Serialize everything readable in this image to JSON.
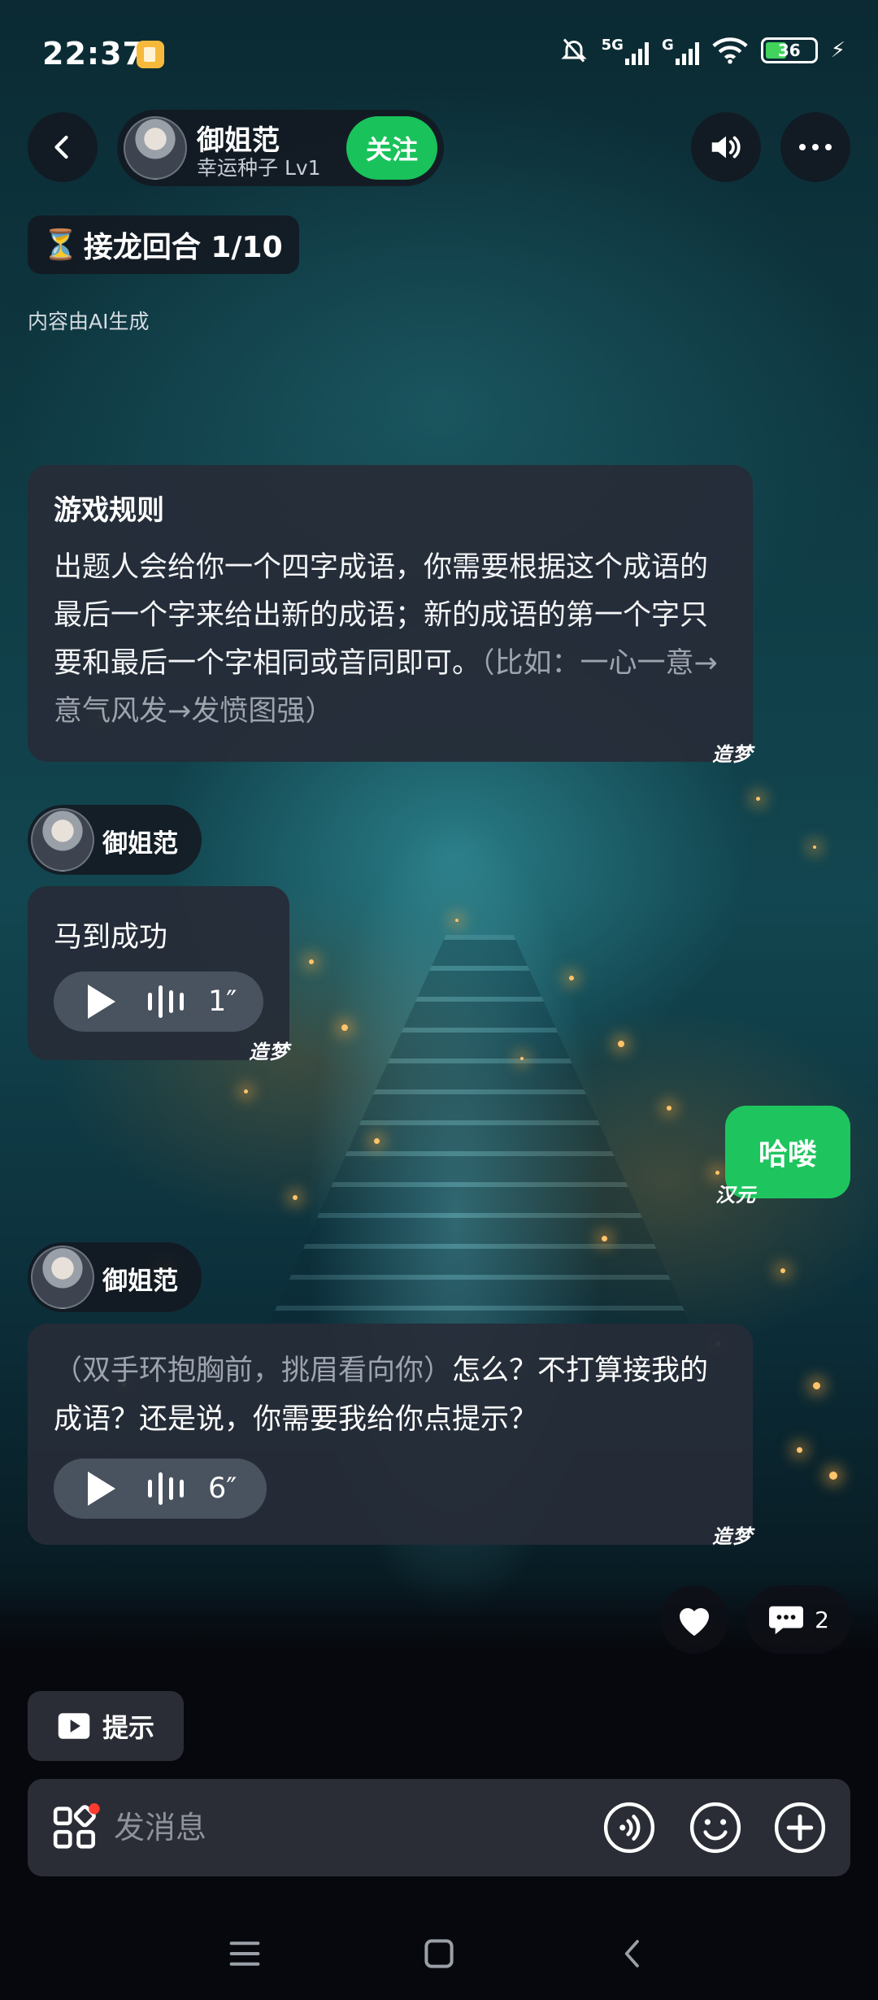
{
  "status_bar": {
    "time": "22:37",
    "network_1": "5G",
    "network_2": "G",
    "battery": "36"
  },
  "header": {
    "profile_name": "御姐范",
    "profile_level": "幸运种子 Lv1",
    "follow_label": "关注"
  },
  "round_badge": {
    "icon": "⏳",
    "label": "接龙回合 1/10"
  },
  "ai_note": "内容由AI生成",
  "rules_card": {
    "title": "游戏规则",
    "text": "出题人会给你一个四字成语，你需要根据这个成语的最后一个字来给出新的成语；新的成语的第一个字只要和最后一个字相同或音同即可。",
    "example": "（比如：一心一意→意气风发→发愤图强）",
    "watermark": "造梦"
  },
  "messages": [
    {
      "sender": "御姐范",
      "text": "马到成功",
      "voice_duration": "1″",
      "watermark": "造梦"
    },
    {
      "from_user": true,
      "text": "哈喽",
      "watermark": "汉元"
    },
    {
      "sender": "御姐范",
      "action": "（双手环抱胸前，挑眉看向你）",
      "text": "怎么？不打算接我的成语？还是说，你需要我给你点提示？",
      "voice_duration": "6″",
      "watermark": "造梦"
    }
  ],
  "reactions": {
    "comment_count": "2"
  },
  "hint_button": "提示",
  "input": {
    "placeholder": "发消息"
  },
  "colors": {
    "accent_green": "#19c25a",
    "bubble_bg": "#262c38",
    "notification_dot": "#ff3b30"
  }
}
